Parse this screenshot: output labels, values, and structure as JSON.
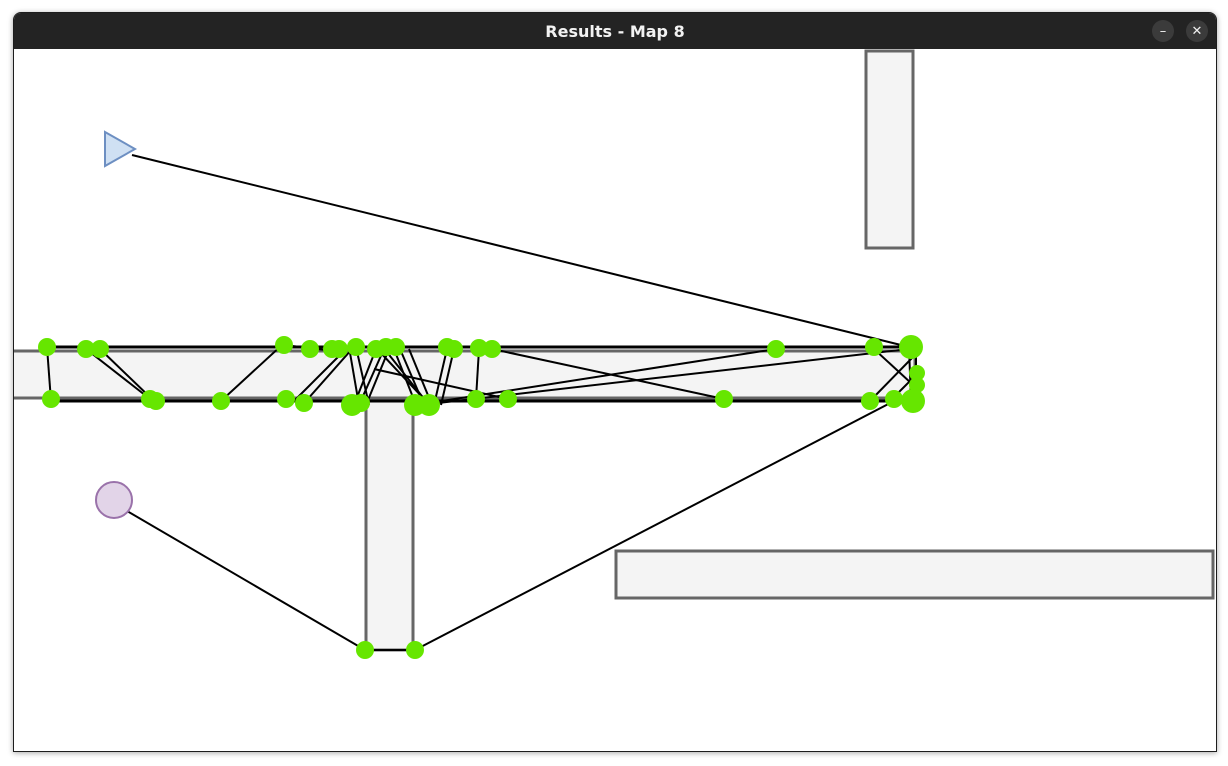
{
  "window": {
    "title": "Results - Map 8",
    "minimize_glyph": "–",
    "close_glyph": "✕"
  },
  "colors": {
    "titlebar": "#232323",
    "obstacle_fill": "#f4f4f4",
    "obstacle_stroke": "#666666",
    "node": "#66e600",
    "edge": "#000000",
    "start_fill": "#cfe0f3",
    "start_stroke": "#6d8fc2",
    "goal_fill": "#e2d4e8",
    "goal_stroke": "#9a72aa"
  },
  "icons": {
    "start": "triangle-right",
    "goal": "circle"
  }
}
